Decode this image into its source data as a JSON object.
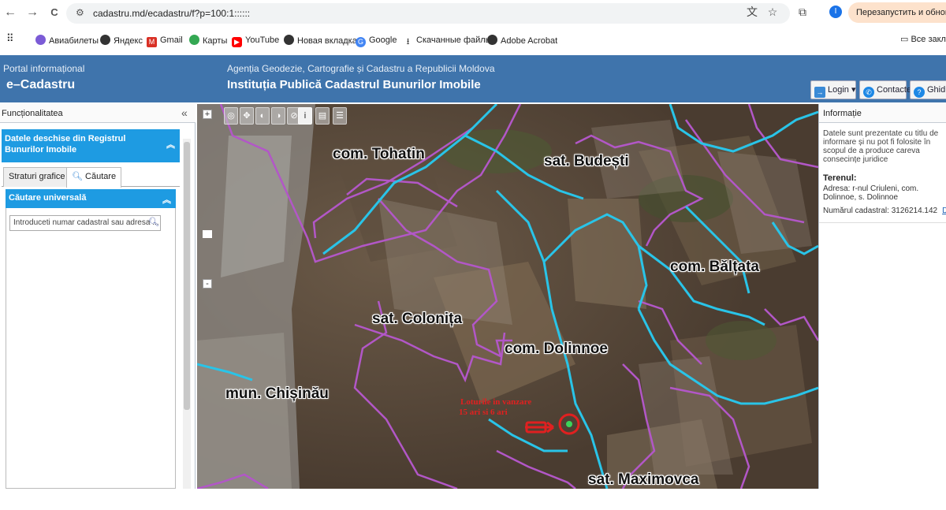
{
  "browser": {
    "back_icon": "←",
    "forward_icon": "→",
    "reload_icon": "C",
    "url": "cadastru.md/ecadastru/f?p=100:1::::::",
    "restart_label": "Перезапустить и обновить",
    "profile_initial": "I"
  },
  "bookmarks": {
    "items": [
      {
        "label": "Авиабилеты",
        "color": "#7b5bd6"
      },
      {
        "label": "Яндекс",
        "color": "#333333"
      },
      {
        "label": "Gmail",
        "color": "#d93025"
      },
      {
        "label": "Карты",
        "color": "#34a853"
      },
      {
        "label": "YouTube",
        "color": "#ff0000"
      },
      {
        "label": "Новая вкладка",
        "color": "#333333"
      },
      {
        "label": "Google",
        "color": "#4285f4"
      },
      {
        "label": "Скачанные файлы",
        "color": "#333333"
      },
      {
        "label": "Adobe Acrobat",
        "color": "#333333"
      }
    ],
    "all_label": "Все закла"
  },
  "header": {
    "portal_small": "Portal informațional",
    "portal_big": "e–Cadastru",
    "agency": "Agenția Geodezie, Cartografie și Cadastru a Republicii Moldova",
    "institution": "Instituția Publică Cadastrul Bunurilor Imobile",
    "login_label": "Login ▾",
    "contacts_label": "Contacte",
    "guide_label": "Ghidul"
  },
  "left_panel": {
    "title": "Funcționalitatea",
    "collapse_icon": "«",
    "open_data_title": "Datele deschise din Registrul Bunurilor Imobile",
    "tabs": [
      "Straturi grafice",
      "Căutare"
    ],
    "search_section": "Căutare universală",
    "search_placeholder": "Introduceti numar cadastral sau adresa ..."
  },
  "map": {
    "zoom_in": "+",
    "zoom_out": "-",
    "labels": {
      "tohatin": "com. Tohatin",
      "budesti": "sat. Budești",
      "baltata": "com. Bălțata",
      "colonita": "sat. Colonița",
      "dolinnoe": "com. Dolinnoe",
      "chisinau": "mun. Chișinău",
      "maximovca": "sat. Maximovca"
    },
    "annotation_line1": "Loturile in vanzare",
    "annotation_line2": "15 ari si 6 ari",
    "boundary_colors": {
      "commune": "#29c4e8",
      "village": "#b257c7",
      "annotation": "#e02020"
    }
  },
  "right_panel": {
    "title": "Informație",
    "disclaimer": "Datele sunt prezentate cu titlu de informare și nu pot fi folosite în scopul de a produce careva consecințe juridice",
    "teren_label": "Terenul:",
    "address": "Adresa: r-nul Criuleni, com. Dolinnoe, s. Dolinnoe",
    "cadastral": "Numărul cadastral: 3126214.142",
    "details_link": "De"
  }
}
